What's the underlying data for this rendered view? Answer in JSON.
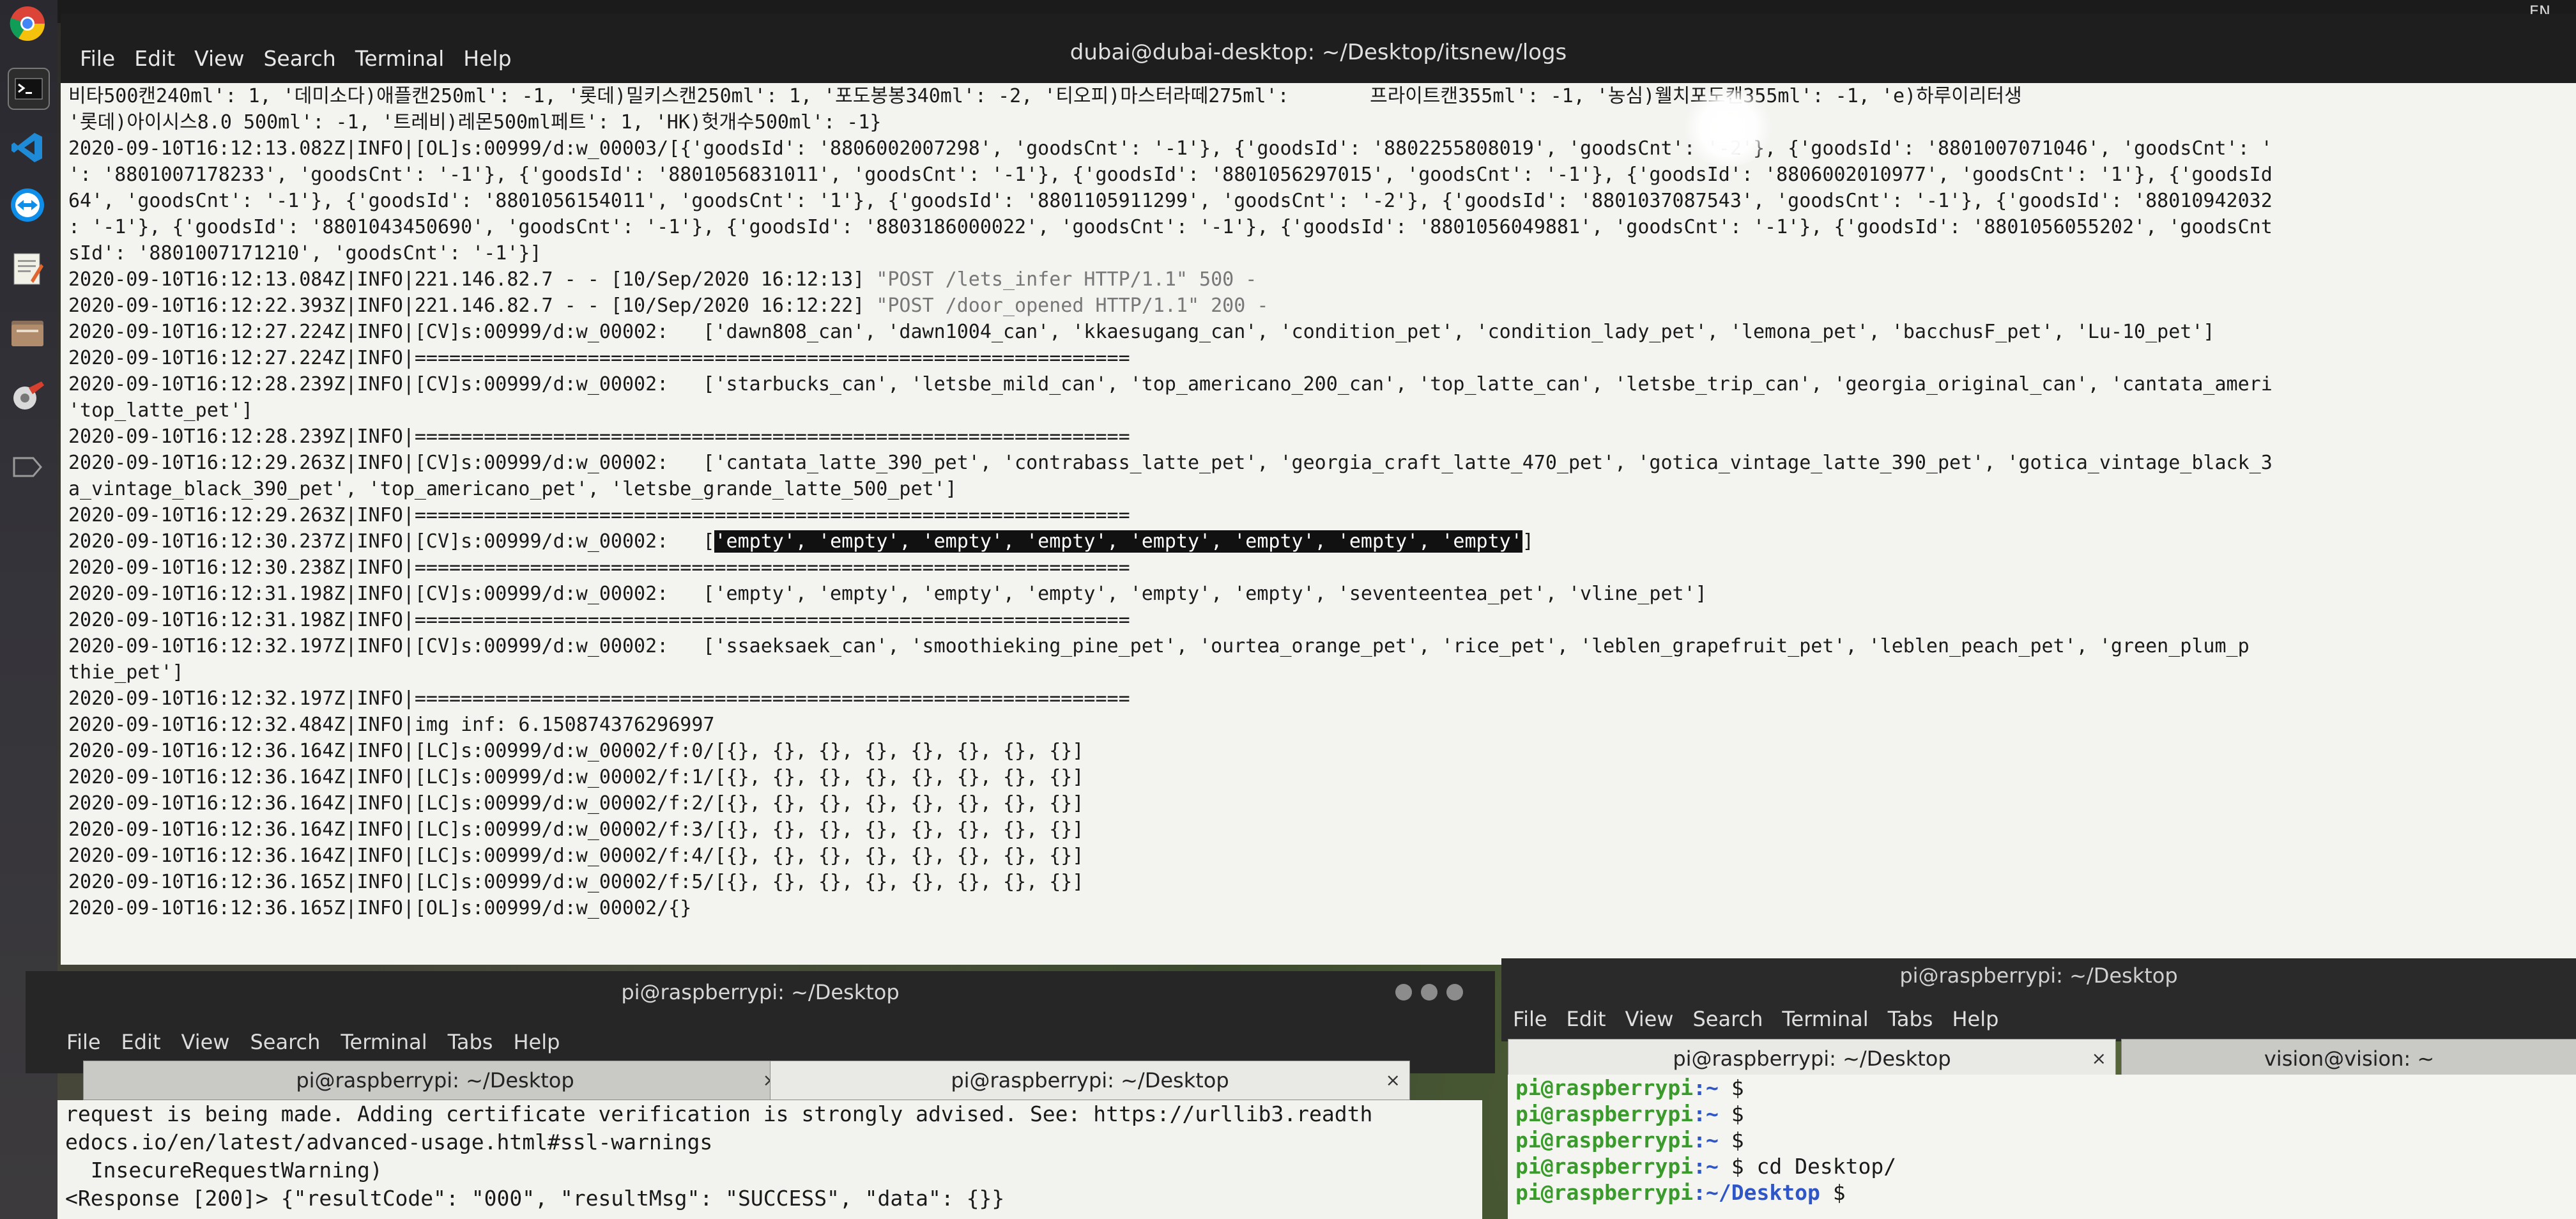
{
  "system": {
    "indicator": "EN"
  },
  "launcher": {
    "items": [
      {
        "name": "chrome-icon"
      },
      {
        "name": "terminal-icon"
      },
      {
        "name": "vscode-icon"
      },
      {
        "name": "teamviewer-icon"
      },
      {
        "name": "text-editor-icon"
      },
      {
        "name": "file-manager-icon"
      },
      {
        "name": "settings-icon"
      },
      {
        "name": "label-icon"
      }
    ]
  },
  "main_terminal": {
    "title": "dubai@dubai-desktop: ~/Desktop/itsnew/logs",
    "menu": [
      "File",
      "Edit",
      "View",
      "Search",
      "Terminal",
      "Help"
    ],
    "lines": [
      "비타500캔240ml': 1, '데미소다)애플캔250ml': -1, '롯데)밀키스캔250ml': 1, '포도봉봉340ml': -2, '티오피)마스터라떼275ml':       프라이트캔355ml': -1, '농심)웰치포도캔355ml': -1, 'e)하루이리터생",
      "'롯데)아이시스8.0 500ml': -1, '트레비)레몬500ml페트': 1, 'HK)헛개수500ml': -1}",
      "2020-09-10T16:12:13.082Z|INFO|[OL]s:00999/d:w_00003/[{'goodsId': '8806002007298', 'goodsCnt': '-1'}, {'goodsId': '8802255808019', 'goodsCnt': '-2'}, {'goodsId': '8801007071046', 'goodsCnt': '",
      "': '8801007178233', 'goodsCnt': '-1'}, {'goodsId': '8801056831011', 'goodsCnt': '-1'}, {'goodsId': '8801056297015', 'goodsCnt': '-1'}, {'goodsId': '8806002010977', 'goodsCnt': '1'}, {'goodsId",
      "64', 'goodsCnt': '-1'}, {'goodsId': '8801056154011', 'goodsCnt': '1'}, {'goodsId': '8801105911299', 'goodsCnt': '-2'}, {'goodsId': '8801037087543', 'goodsCnt': '-1'}, {'goodsId': '88010942032",
      ": '-1'}, {'goodsId': '8801043450690', 'goodsCnt': '-1'}, {'goodsId': '8803186000022', 'goodsCnt': '-1'}, {'goodsId': '8801056049881', 'goodsCnt': '-1'}, {'goodsId': '8801056055202', 'goodsCnt",
      "sId': '8801007171210', 'goodsCnt': '-1'}]",
      "2020-09-10T16:12:13.084Z|INFO|221.146.82.7 - - [10/Sep/2020 16:12:13] ",
      "2020-09-10T16:12:22.393Z|INFO|221.146.82.7 - - [10/Sep/2020 16:12:22] ",
      "2020-09-10T16:12:27.224Z|INFO|[CV]s:00999/d:w_00002:   ['dawn808_can', 'dawn1004_can', 'kkaesugang_can', 'condition_pet', 'condition_lady_pet', 'lemona_pet', 'bacchusF_pet', 'Lu-10_pet']",
      "2020-09-10T16:12:27.224Z|INFO|==============================================================",
      "2020-09-10T16:12:28.239Z|INFO|[CV]s:00999/d:w_00002:   ['starbucks_can', 'letsbe_mild_can', 'top_americano_200_can', 'top_latte_can', 'letsbe_trip_can', 'georgia_original_can', 'cantata_ameri",
      "'top_latte_pet']",
      "2020-09-10T16:12:28.239Z|INFO|==============================================================",
      "2020-09-10T16:12:29.263Z|INFO|[CV]s:00999/d:w_00002:   ['cantata_latte_390_pet', 'contrabass_latte_pet', 'georgia_craft_latte_470_pet', 'gotica_vintage_latte_390_pet', 'gotica_vintage_black_3",
      "a_vintage_black_390_pet', 'top_americano_pet', 'letsbe_grande_latte_500_pet']",
      "2020-09-10T16:12:29.263Z|INFO|==============================================================",
      "2020-09-10T16:12:30.237Z|INFO|[CV]s:00999/d:w_00002:   [",
      "2020-09-10T16:12:30.238Z|INFO|==============================================================",
      "2020-09-10T16:12:31.198Z|INFO|[CV]s:00999/d:w_00002:   ['empty', 'empty', 'empty', 'empty', 'empty', 'empty', 'seventeentea_pet', 'vline_pet']",
      "2020-09-10T16:12:31.198Z|INFO|==============================================================",
      "2020-09-10T16:12:32.197Z|INFO|[CV]s:00999/d:w_00002:   ['ssaeksaek_can', 'smoothieking_pine_pet', 'ourtea_orange_pet', 'rice_pet', 'leblen_grapefruit_pet', 'leblen_peach_pet', 'green_plum_p",
      "thie_pet']",
      "2020-09-10T16:12:32.197Z|INFO|==============================================================",
      "2020-09-10T16:12:32.484Z|INFO|img inf: 6.150874376296997",
      "2020-09-10T16:12:36.164Z|INFO|[LC]s:00999/d:w_00002/f:0/[{}, {}, {}, {}, {}, {}, {}, {}]",
      "2020-09-10T16:12:36.164Z|INFO|[LC]s:00999/d:w_00002/f:1/[{}, {}, {}, {}, {}, {}, {}, {}]",
      "2020-09-10T16:12:36.164Z|INFO|[LC]s:00999/d:w_00002/f:2/[{}, {}, {}, {}, {}, {}, {}, {}]",
      "2020-09-10T16:12:36.164Z|INFO|[LC]s:00999/d:w_00002/f:3/[{}, {}, {}, {}, {}, {}, {}, {}]",
      "2020-09-10T16:12:36.164Z|INFO|[LC]s:00999/d:w_00002/f:4/[{}, {}, {}, {}, {}, {}, {}, {}]",
      "2020-09-10T16:12:36.165Z|INFO|[LC]s:00999/d:w_00002/f:5/[{}, {}, {}, {}, {}, {}, {}, {}]",
      "2020-09-10T16:12:36.165Z|INFO|[OL]s:00999/d:w_00002/{}"
    ],
    "request_1": "\"POST /lets_infer HTTP/1.1\" 500 -",
    "request_2": "\"POST /door_opened HTTP/1.1\" 200 -",
    "selected_text": "'empty', 'empty', 'empty', 'empty', 'empty', 'empty', 'empty', 'empty'",
    "selected_tail": "]"
  },
  "left_terminal": {
    "title": "pi@raspberrypi: ~/Desktop",
    "menu": [
      "File",
      "Edit",
      "View",
      "Search",
      "Terminal",
      "Tabs",
      "Help"
    ],
    "tabs": [
      {
        "label": "pi@raspberrypi: ~/Desktop",
        "active": false
      },
      {
        "label": "pi@raspberrypi: ~/Desktop",
        "active": true
      }
    ],
    "close_glyph": "×",
    "lines": [
      "request is being made. Adding certificate verification is strongly advised. See: https://urllib3.readth",
      "edocs.io/en/latest/advanced-usage.html#ssl-warnings",
      "  InsecureRequestWarning)",
      "<Response [200]> {\"resultCode\": \"000\", \"resultMsg\": \"SUCCESS\", \"data\": {}}"
    ]
  },
  "right_terminal": {
    "title": "pi@raspberrypi: ~/Desktop",
    "menu": [
      "File",
      "Edit",
      "View",
      "Search",
      "Terminal",
      "Tabs",
      "Help"
    ],
    "tabs": [
      {
        "label": "pi@raspberrypi: ~/Desktop",
        "active": true
      },
      {
        "label": "vision@vision: ~",
        "active": false
      }
    ],
    "close_glyph": "×",
    "prompt_user": "pi@raspberrypi",
    "prompt_sep": ":",
    "lines": [
      {
        "path": "~",
        "cmd": ""
      },
      {
        "path": "~",
        "cmd": ""
      },
      {
        "path": "~",
        "cmd": ""
      },
      {
        "path": "~",
        "cmd": "cd Desktop/"
      },
      {
        "path": "~/Desktop",
        "cmd": ""
      }
    ],
    "prompt_suffix": " $ "
  },
  "colors": {
    "terminal_bg": "#f3f3f0",
    "prompt_green": "#3a9b2c",
    "prompt_blue": "#2f56c7",
    "selection_bg": "#111111"
  }
}
